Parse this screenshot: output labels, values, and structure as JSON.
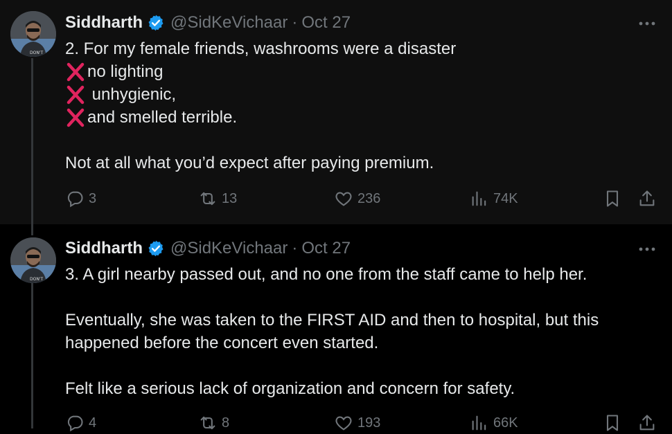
{
  "tweets": [
    {
      "name": "Siddharth",
      "handle": "@SidKeVichaar",
      "separator": "·",
      "date": "Oct 27",
      "lines": [
        "2. For my female friends, washrooms were a disaster",
        "no lighting",
        " unhygienic,",
        "and smelled terrible.",
        "Not at all what you’d expect after paying premium."
      ],
      "stats": {
        "replies": "3",
        "retweets": "13",
        "likes": "236",
        "views": "74K"
      }
    },
    {
      "name": "Siddharth",
      "handle": "@SidKeVichaar",
      "separator": "·",
      "date": "Oct 27",
      "lines": [
        "3. A girl nearby passed out, and no one from the staff came to help her.",
        "Eventually, she was taken to the FIRST AID and then to hospital, but this happened before the concert even started.",
        "Felt like a serious lack of organization and concern for safety."
      ],
      "stats": {
        "replies": "4",
        "retweets": "8",
        "likes": "193",
        "views": "66K"
      }
    }
  ],
  "avatar_badge_text": "DON'T",
  "colors": {
    "background_first": "#0f0f0f",
    "background_second": "#000000",
    "text": "#e7e9ea",
    "muted": "#71767b",
    "verified": "#1d9bf0",
    "cross": "#e0245e"
  }
}
